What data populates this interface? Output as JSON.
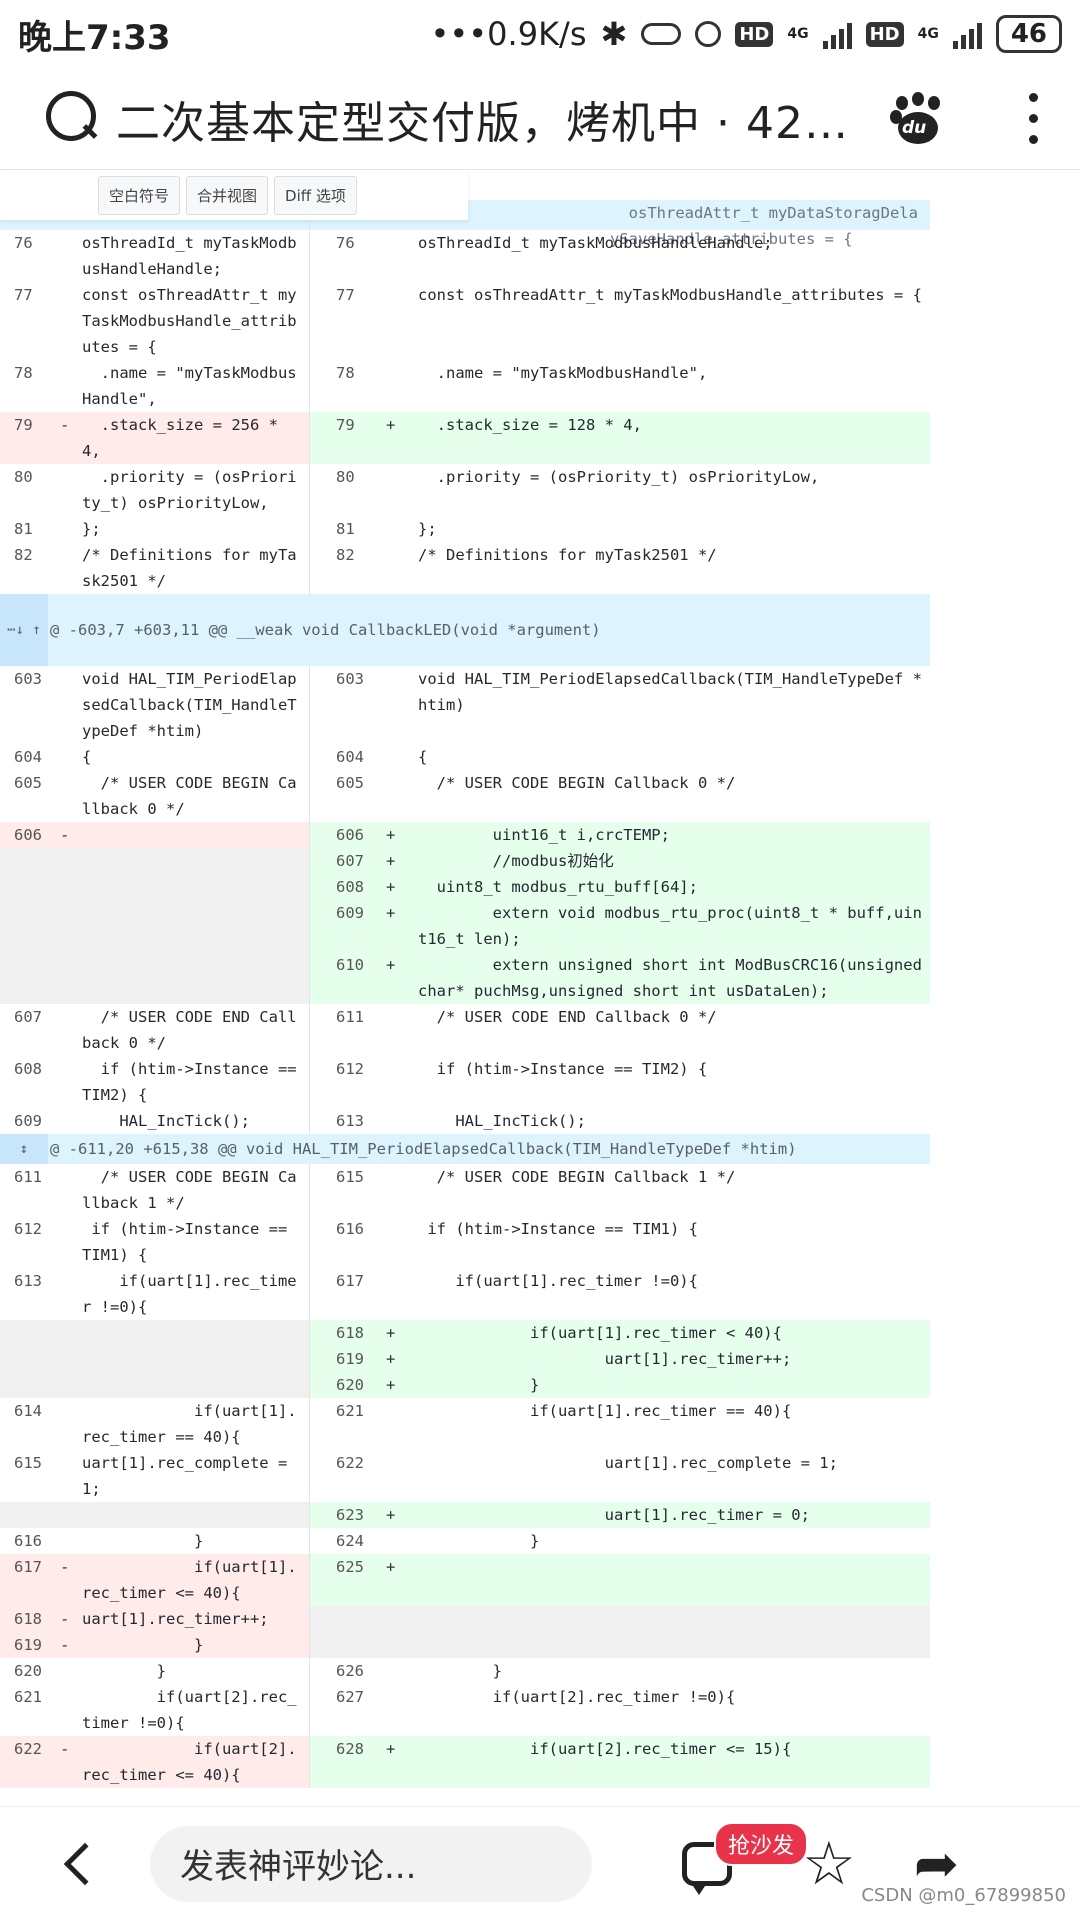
{
  "status": {
    "time": "晚上7:33",
    "speed": "•••0.9K/s",
    "bt": "✱",
    "hd1": "HD",
    "net1": "4G",
    "hd2": "HD",
    "net2": "4G",
    "battery": "46"
  },
  "header": {
    "title": "二次基本定型交付版，烤机中 · 42d..."
  },
  "toolbar": {
    "whitespace": "空白符号",
    "merge_view": "合并视图",
    "diff_options": "Diff 选项"
  },
  "diff": {
    "first_line_left": "",
    "first_line_right": "  osThreadAttr_t myDataStoragDelaySaveHandle_attributes = {",
    "hunks": [
      "@ -603,7 +603,11 @@ __weak void CallbackLED(void *argument)",
      "@ -611,20 +615,38 @@ void HAL_TIM_PeriodElapsedCallback(TIM_HandleTypeDef *htim)"
    ],
    "rows": [
      {
        "l": "76",
        "lt": "osThreadId_t myTaskModbusHandleHandle;",
        "r": "76",
        "rt": "osThreadId_t myTaskModbusHandleHandle;"
      },
      {
        "l": "77",
        "lt": "const osThreadAttr_t myTaskModbusHandle_attributes = {",
        "r": "77",
        "rt": "const osThreadAttr_t myTaskModbusHandle_attributes = {"
      },
      {
        "l": "78",
        "lt": "  .name = \"myTaskModbusHandle\",",
        "r": "78",
        "rt": "  .name = \"myTaskModbusHandle\","
      },
      {
        "l": "79",
        "lt": "  .stack_size = 256 * 4,",
        "r": "79",
        "rt": "  .stack_size = 128 * 4,",
        "type": "change"
      },
      {
        "l": "80",
        "lt": "  .priority = (osPriority_t) osPriorityLow,",
        "r": "80",
        "rt": "  .priority = (osPriority_t) osPriorityLow,"
      },
      {
        "l": "81",
        "lt": "};",
        "r": "81",
        "rt": "};"
      },
      {
        "l": "82",
        "lt": "/* Definitions for myTask2501 */",
        "r": "82",
        "rt": "/* Definitions for myTask2501 */"
      },
      {
        "hunk": 0
      },
      {
        "l": "603",
        "lt": "void HAL_TIM_PeriodElapsedCallback(TIM_HandleTypeDef *htim)",
        "r": "603",
        "rt": "void HAL_TIM_PeriodElapsedCallback(TIM_HandleTypeDef *htim)"
      },
      {
        "l": "604",
        "lt": "{",
        "r": "604",
        "rt": "{"
      },
      {
        "l": "605",
        "lt": "  /* USER CODE BEGIN Callback 0 */",
        "r": "605",
        "rt": "  /* USER CODE BEGIN Callback 0 */"
      },
      {
        "l": "606",
        "lt": "",
        "r": "606",
        "rt": "        uint16_t i,crcTEMP;",
        "type": "change"
      },
      {
        "l": "",
        "lt": "",
        "r": "607",
        "rt": "        //modbus初始化",
        "type": "addonly"
      },
      {
        "l": "",
        "lt": "",
        "r": "608",
        "rt": "  uint8_t modbus_rtu_buff[64];",
        "type": "addonly"
      },
      {
        "l": "",
        "lt": "",
        "r": "609",
        "rt": "        extern void modbus_rtu_proc(uint8_t * buff,uint16_t len);",
        "type": "addonly"
      },
      {
        "l": "",
        "lt": "",
        "r": "610",
        "rt": "        extern unsigned short int ModBusCRC16(unsigned char* puchMsg,unsigned short int usDataLen);",
        "type": "addonly"
      },
      {
        "l": "607",
        "lt": "  /* USER CODE END Callback 0 */",
        "r": "611",
        "rt": "  /* USER CODE END Callback 0 */"
      },
      {
        "l": "608",
        "lt": "  if (htim->Instance == TIM2) {",
        "r": "612",
        "rt": "  if (htim->Instance == TIM2) {"
      },
      {
        "l": "609",
        "lt": "    HAL_IncTick();",
        "r": "613",
        "rt": "    HAL_IncTick();"
      },
      {
        "hunk": 1
      },
      {
        "l": "611",
        "lt": "  /* USER CODE BEGIN Callback 1 */",
        "r": "615",
        "rt": "  /* USER CODE BEGIN Callback 1 */"
      },
      {
        "l": "612",
        "lt": " if (htim->Instance == TIM1) {",
        "r": "616",
        "rt": " if (htim->Instance == TIM1) {"
      },
      {
        "l": "613",
        "lt": "    if(uart[1].rec_timer !=0){",
        "r": "617",
        "rt": "    if(uart[1].rec_timer !=0){"
      },
      {
        "l": "",
        "lt": "",
        "r": "618",
        "rt": "            if(uart[1].rec_timer < 40){",
        "type": "addonly"
      },
      {
        "l": "",
        "lt": "",
        "r": "619",
        "rt": "                    uart[1].rec_timer++;",
        "type": "addonly"
      },
      {
        "l": "",
        "lt": "",
        "r": "620",
        "rt": "            }",
        "type": "addonly"
      },
      {
        "l": "614",
        "lt": "            if(uart[1].rec_timer == 40){",
        "r": "621",
        "rt": "            if(uart[1].rec_timer == 40){"
      },
      {
        "l": "615",
        "lt": "uart[1].rec_complete = 1;",
        "r": "622",
        "rt": "                    uart[1].rec_complete = 1;"
      },
      {
        "l": "",
        "lt": "",
        "r": "623",
        "rt": "                    uart[1].rec_timer = 0;",
        "type": "addonly"
      },
      {
        "l": "616",
        "lt": "            }",
        "r": "624",
        "rt": "            }"
      },
      {
        "l": "617",
        "lt": "            if(uart[1].rec_timer <= 40){",
        "r": "625",
        "rt": "",
        "type": "change"
      },
      {
        "l": "618",
        "lt": "uart[1].rec_timer++;",
        "r": "",
        "rt": "",
        "type": "delonly"
      },
      {
        "l": "619",
        "lt": "            }",
        "r": "",
        "rt": "",
        "type": "delonly"
      },
      {
        "l": "620",
        "lt": "        }",
        "r": "626",
        "rt": "        }"
      },
      {
        "l": "621",
        "lt": "        if(uart[2].rec_timer !=0){",
        "r": "627",
        "rt": "        if(uart[2].rec_timer !=0){"
      },
      {
        "l": "622",
        "lt": "            if(uart[2].rec_timer <= 40){",
        "r": "628",
        "rt": "            if(uart[2].rec_timer <= 15){",
        "type": "change"
      }
    ]
  },
  "bottom": {
    "comment_placeholder": "发表神评妙论...",
    "badge": "抢沙发",
    "star": "☆",
    "share": "➦"
  },
  "watermark": "CSDN @m0_67899850"
}
